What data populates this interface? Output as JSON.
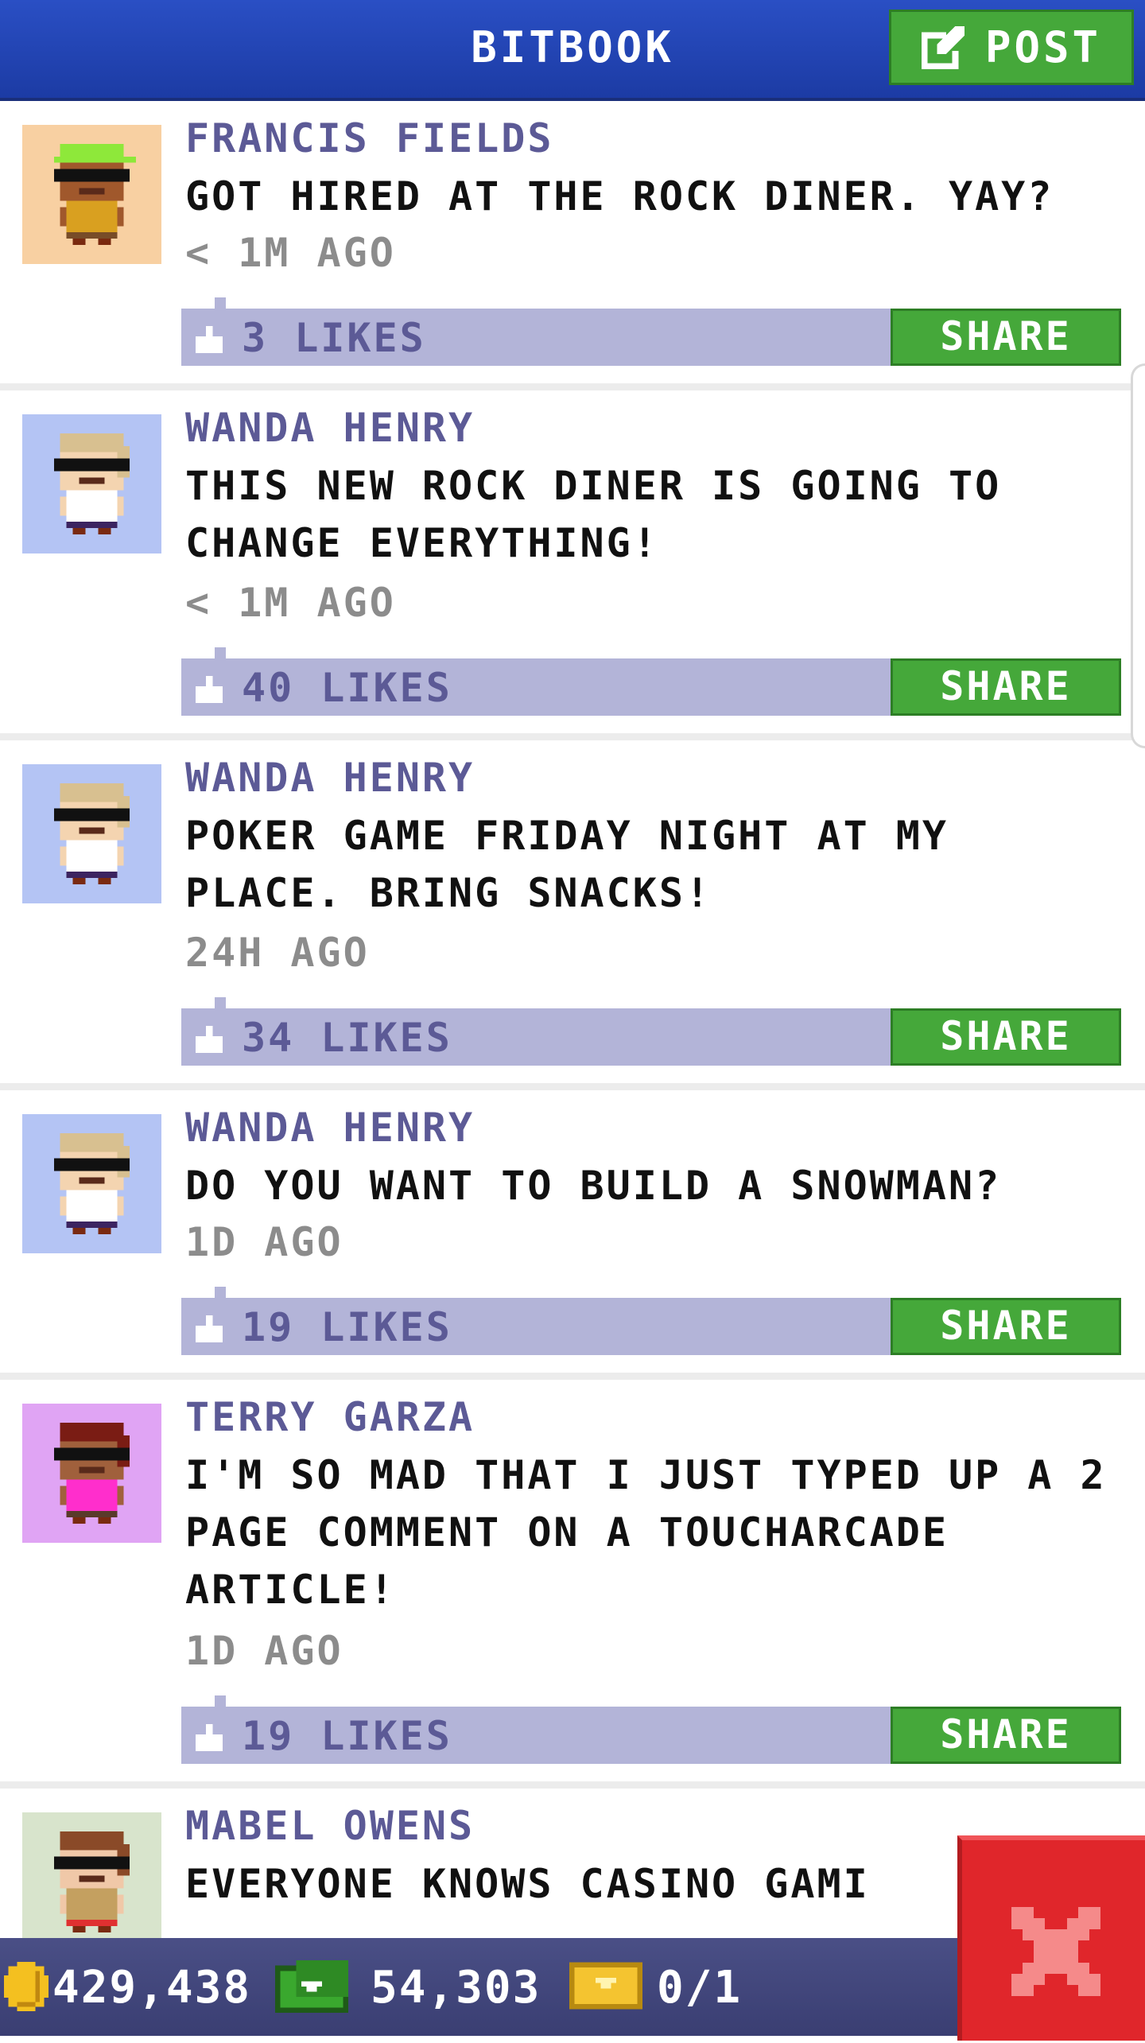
{
  "header": {
    "title": "BITBOOK",
    "post_label": "POST"
  },
  "posts": [
    {
      "author": "FRANCIS FIELDS",
      "text": "GOT HIRED AT THE ROCK DINER. YAY?",
      "time": "< 1M AGO",
      "likes": "3 LIKES",
      "share": "SHARE",
      "avatar": {
        "bg": "#f8d0a2",
        "skin": "#a0582c",
        "hair": "#8ee83a",
        "shirt": "#d9a020",
        "pants": "#784c28",
        "hat": true
      }
    },
    {
      "author": "WANDA HENRY",
      "text": "THIS NEW ROCK DINER IS GOING TO CHANGE EVERYTHING!",
      "time": "< 1M AGO",
      "likes": "40 LIKES",
      "share": "SHARE",
      "avatar": {
        "bg": "#b4c4f4",
        "skin": "#f4d4b0",
        "hair": "#d8c090",
        "shirt": "#ffffff",
        "pants": "#3c2460",
        "hat": false
      }
    },
    {
      "author": "WANDA HENRY",
      "text": "POKER GAME FRIDAY NIGHT AT MY PLACE. BRING SNACKS!",
      "time": "24H AGO",
      "likes": "34 LIKES",
      "share": "SHARE",
      "avatar": {
        "bg": "#b4c4f4",
        "skin": "#f4d4b0",
        "hair": "#d8c090",
        "shirt": "#ffffff",
        "pants": "#3c2460",
        "hat": false
      }
    },
    {
      "author": "WANDA HENRY",
      "text": "DO YOU WANT TO BUILD A SNOWMAN?",
      "time": "1D AGO",
      "likes": "19 LIKES",
      "share": "SHARE",
      "avatar": {
        "bg": "#b4c4f4",
        "skin": "#f4d4b0",
        "hair": "#d8c090",
        "shirt": "#ffffff",
        "pants": "#3c2460",
        "hat": false
      }
    },
    {
      "author": "TERRY GARZA",
      "text": "I'M SO MAD THAT I JUST TYPED UP A 2 PAGE COMMENT ON A TOUCHARCADE ARTICLE!",
      "time": "1D AGO",
      "likes": "19 LIKES",
      "share": "SHARE",
      "avatar": {
        "bg": "#e0a4f4",
        "skin": "#a0603c",
        "hair": "#7a1c14",
        "shirt": "#ff2ecc",
        "pants": "#5a3a2a",
        "hat": false
      }
    },
    {
      "author": "MABEL OWENS",
      "text": "EVERYONE KNOWS CASINO GAMI",
      "time": "",
      "likes": "",
      "share": "",
      "avatar": {
        "bg": "#d8e4cc",
        "skin": "#f0c8a8",
        "hair": "#8a4a28",
        "shirt": "#c4a060",
        "pants": "#e03030",
        "hat": false
      }
    }
  ],
  "footer": {
    "coins": "429,438",
    "bux": "54,303",
    "tickets": "0/1"
  },
  "colors": {
    "header_blue": "#2a4fc4",
    "share_green": "#45a83a",
    "likes_bar": "#b3b4d8",
    "name_purple": "#5c5a96",
    "close_red": "#e0262b"
  },
  "icons": {
    "post": "edit-icon",
    "thumb": "thumbs-up-icon",
    "coin": "coin-icon",
    "bux": "cash-icon",
    "ticket": "ticket-icon",
    "close": "close-icon"
  }
}
